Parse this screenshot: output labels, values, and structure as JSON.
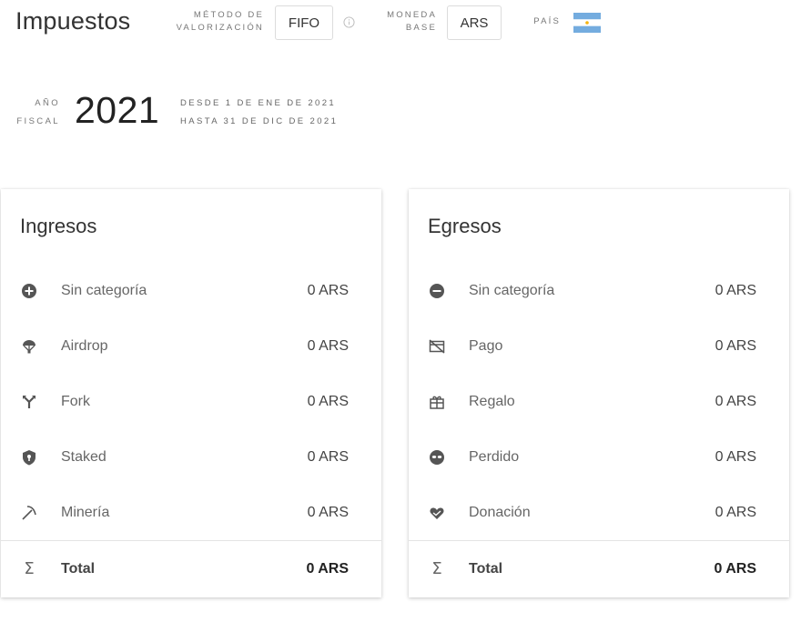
{
  "header": {
    "title": "Impuestos",
    "valuation_method": {
      "label_line1": "MÉTODO DE",
      "label_line2": "VALORIZACIÓN",
      "value": "FIFO"
    },
    "base_currency": {
      "label_line1": "MONEDA",
      "label_line2": "BASE",
      "value": "ARS"
    },
    "country": {
      "label": "PAÍS",
      "flag": "argentina-flag"
    }
  },
  "fiscal_year": {
    "label_line1": "AÑO",
    "label_line2": "FISCAL",
    "year": "2021",
    "from": "DESDE 1 DE ENE DE 2021",
    "to": "HASTA 31 DE DIC DE 2021"
  },
  "income": {
    "title": "Ingresos",
    "rows": [
      {
        "icon": "plus-circle-icon",
        "name": "Sin categoría",
        "value": "0 ARS"
      },
      {
        "icon": "parachute-icon",
        "name": "Airdrop",
        "value": "0 ARS"
      },
      {
        "icon": "fork-icon",
        "name": "Fork",
        "value": "0 ARS"
      },
      {
        "icon": "shield-icon",
        "name": "Staked",
        "value": "0 ARS"
      },
      {
        "icon": "pickaxe-icon",
        "name": "Minería",
        "value": "0 ARS"
      }
    ],
    "total": {
      "icon": "sigma-icon",
      "name": "Total",
      "value": "0 ARS"
    }
  },
  "expenses": {
    "title": "Egresos",
    "rows": [
      {
        "icon": "minus-circle-icon",
        "name": "Sin categoría",
        "value": "0 ARS"
      },
      {
        "icon": "credit-card-off-icon",
        "name": "Pago",
        "value": "0 ARS"
      },
      {
        "icon": "gift-icon",
        "name": "Regalo",
        "value": "0 ARS"
      },
      {
        "icon": "mask-icon",
        "name": "Perdido",
        "value": "0 ARS"
      },
      {
        "icon": "heart-hand-icon",
        "name": "Donación",
        "value": "0 ARS"
      }
    ],
    "total": {
      "icon": "sigma-icon",
      "name": "Total",
      "value": "0 ARS"
    }
  },
  "colors": {
    "icon": "#555555",
    "flag_blue": "#74acdf",
    "flag_sun": "#f6b40e"
  }
}
